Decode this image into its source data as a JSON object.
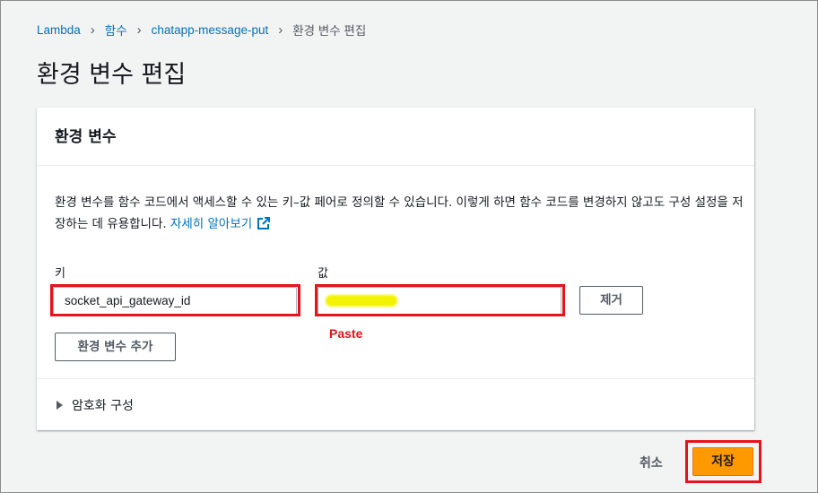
{
  "breadcrumb": {
    "items": [
      "Lambda",
      "함수",
      "chatapp-message-put",
      "환경 변수 편집"
    ]
  },
  "page_title": "환경 변수 편집",
  "panel": {
    "title": "환경 변수",
    "description": "환경 변수를 함수 코드에서 액세스할 수 있는 키–값 페어로 정의할 수 있습니다. 이렇게 하면 함수 코드를 변경하지 않고도 구성 설정을 저장하는 데 유용합니다. ",
    "learn_more": "자세히 알아보기",
    "key_label": "키",
    "value_label": "값",
    "key_value": "socket_api_gateway_id",
    "value_value": "",
    "remove_button": "제거",
    "add_button": "환경 변수 추가",
    "paste_annotation": "Paste",
    "encryption_label": "암호화 구성"
  },
  "footer": {
    "cancel": "취소",
    "save": "저장"
  },
  "colors": {
    "link": "#0073bb",
    "primary": "#ff9900",
    "annotation_red": "#e5131c"
  }
}
